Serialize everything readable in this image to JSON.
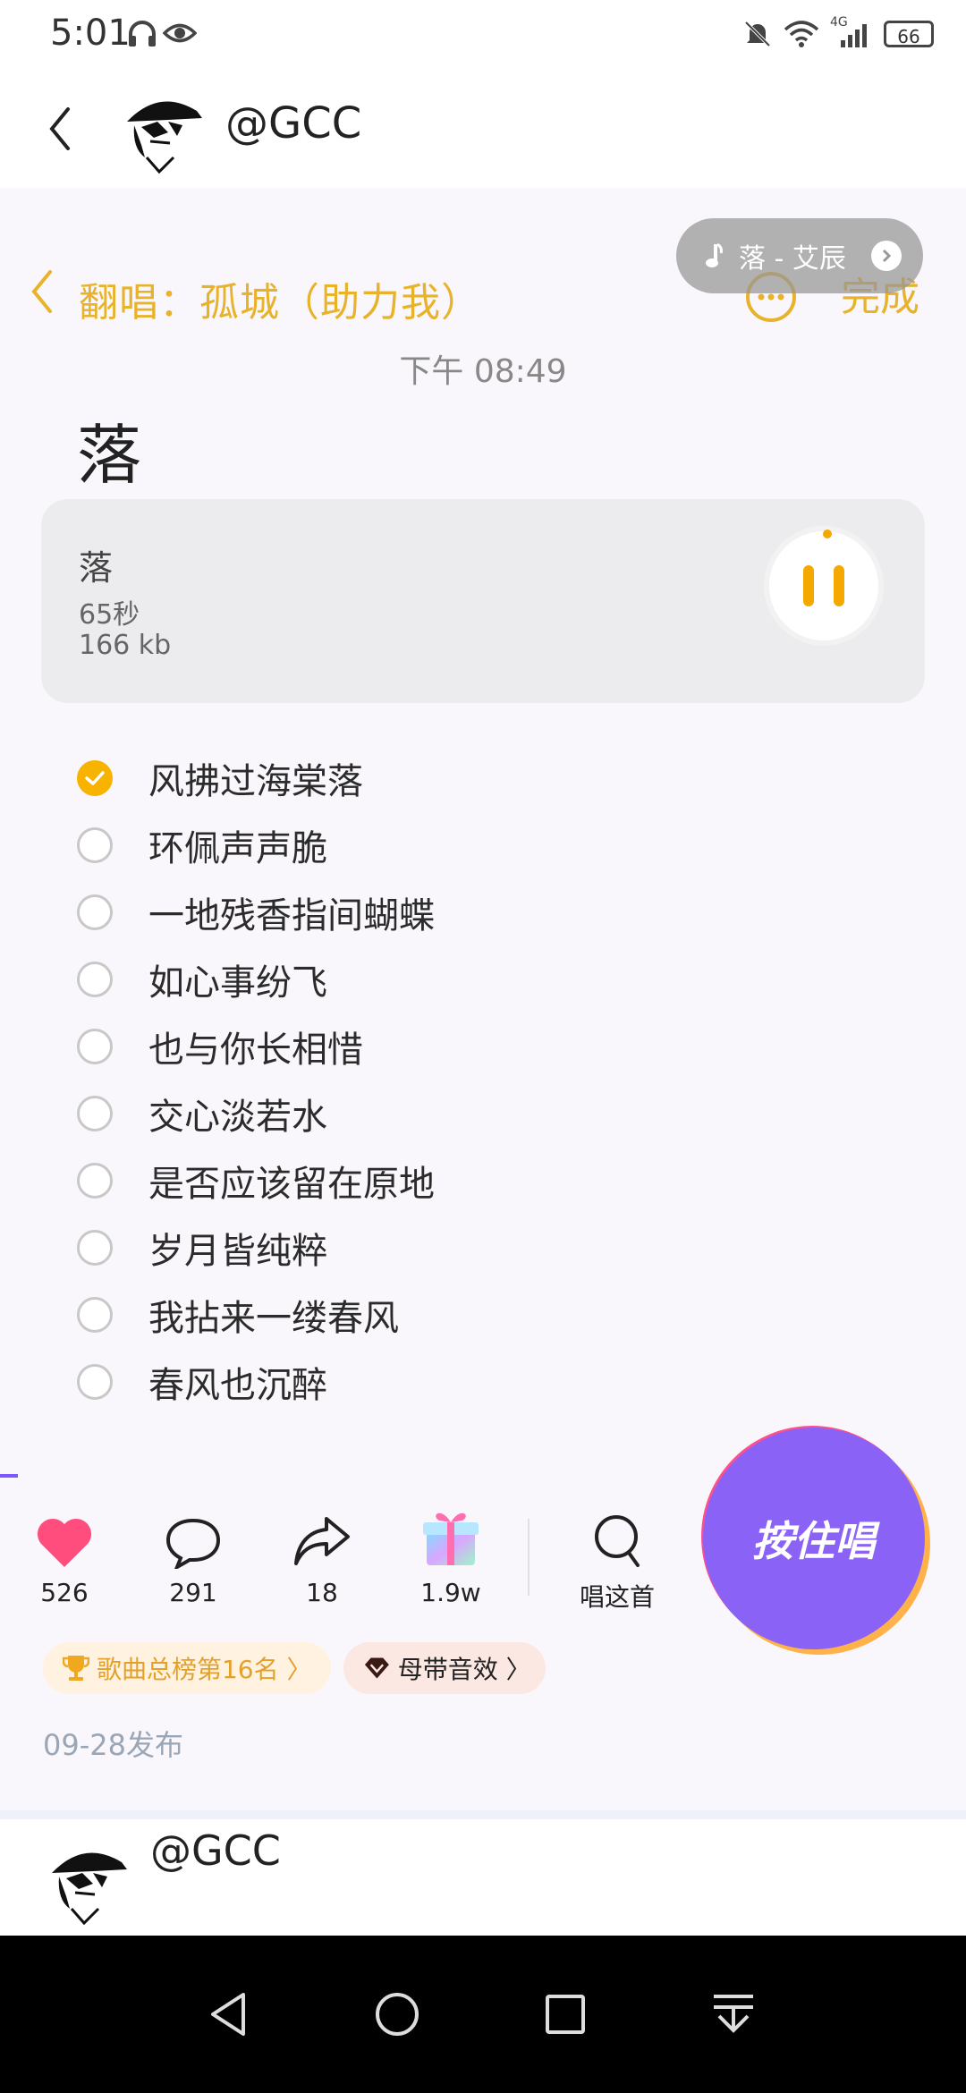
{
  "status_bar": {
    "time": "5:01",
    "network": "4G",
    "battery": "66"
  },
  "top_nav": {
    "username": "@GCC"
  },
  "cover": {
    "title": "翻唱：孤城（助力我）"
  },
  "now_playing": {
    "label": "落 - 艾辰"
  },
  "header": {
    "done_label": "完成"
  },
  "note": {
    "time": "下午 08:49",
    "title": "落"
  },
  "audio": {
    "name": "落",
    "duration": "65秒",
    "size": "166 kb",
    "progress": 0.02
  },
  "checklist": [
    {
      "label": "风拂过海棠落",
      "checked": true
    },
    {
      "label": "环佩声声脆",
      "checked": false
    },
    {
      "label": "一地残香指间蝴蝶",
      "checked": false
    },
    {
      "label": "如心事纷飞",
      "checked": false
    },
    {
      "label": "也与你长相惜",
      "checked": false
    },
    {
      "label": "交心淡若水",
      "checked": false
    },
    {
      "label": "是否应该留在原地",
      "checked": false
    },
    {
      "label": "岁月皆纯粹",
      "checked": false
    },
    {
      "label": "我拈来一缕春风",
      "checked": false
    },
    {
      "label": "春风也沉醉",
      "checked": false
    }
  ],
  "actions": {
    "likes": "526",
    "comments": "291",
    "shares": "18",
    "gifts": "1.9w",
    "sing_this": "唱这首",
    "hold_sing": "按住唱"
  },
  "tags": {
    "rank": "歌曲总榜第16名 〉",
    "effect": "母带音效 〉"
  },
  "publish_date": "09-28发布",
  "comment": {
    "username": "@GCC"
  },
  "colors": {
    "accent": "#e8b32a",
    "purple": "#8a63f6",
    "like": "#ff4d7e"
  }
}
